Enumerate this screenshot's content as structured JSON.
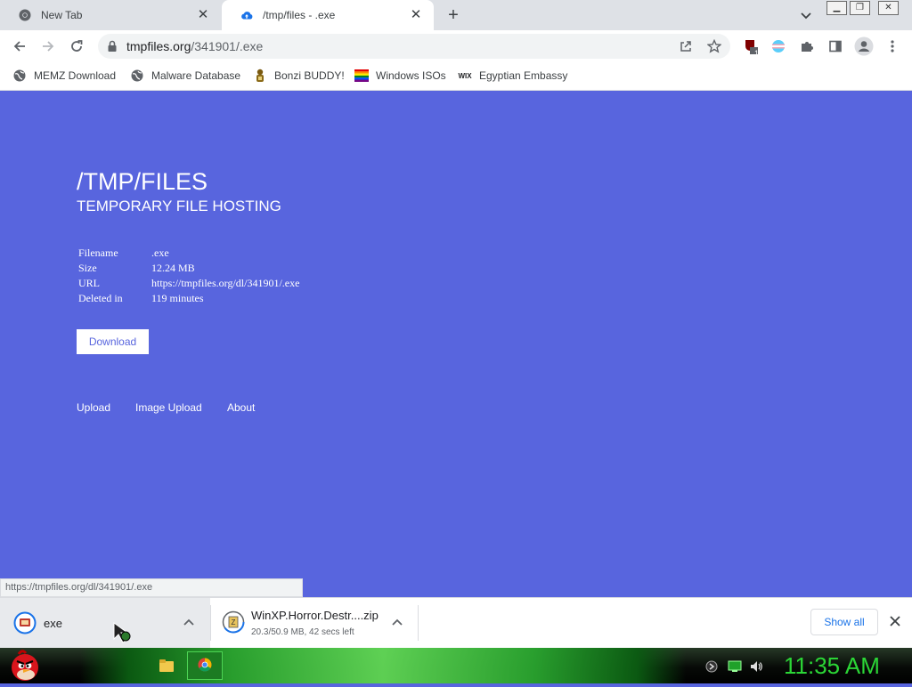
{
  "browser": {
    "tabs": [
      {
        "label": "New Tab",
        "icon": "chrome-icon"
      },
      {
        "label": "/tmp/files - .exe",
        "icon": "cloud-upload-icon"
      }
    ],
    "new_tab_symbol": "+",
    "address": {
      "host": "tmpfiles.org",
      "path": "/341901/.exe"
    },
    "bookmarks": [
      {
        "label": "MEMZ Download",
        "icon": "globe-icon"
      },
      {
        "label": "Malware Database",
        "icon": "globe-icon"
      },
      {
        "label": "Bonzi BUDDY!",
        "icon": "bonzi-icon"
      },
      {
        "label": "Windows ISOs",
        "icon": "windows-flag-icon"
      },
      {
        "label": "Egyptian Embassy",
        "icon": "wix-icon"
      }
    ],
    "extension_badge": "1",
    "accent": "#1a73e8"
  },
  "page": {
    "background": "#5865de",
    "title": "/TMP/FILES",
    "subtitle": "TEMPORARY FILE HOSTING",
    "info_rows": [
      {
        "key": "Filename",
        "value": ".exe"
      },
      {
        "key": "Size",
        "value": "12.24 MB"
      },
      {
        "key": "URL",
        "value": "https://tmpfiles.org/dl/341901/.exe"
      },
      {
        "key": "Deleted in",
        "value": "119 minutes"
      }
    ],
    "download_label": "Download",
    "nav": [
      "Upload",
      "Image Upload",
      "About"
    ]
  },
  "status_bar": {
    "text": "https://tmpfiles.org/dl/341901/.exe"
  },
  "downloads": {
    "items": [
      {
        "name": "exe",
        "detail": ""
      },
      {
        "name": "WinXP.Horror.Destr....zip",
        "detail": "20.3/50.9 MB, 42 secs left"
      }
    ],
    "show_all_label": "Show all"
  },
  "taskbar": {
    "clock": "11:35 AM",
    "clock_color": "#2bd636"
  }
}
